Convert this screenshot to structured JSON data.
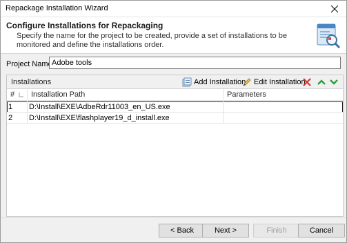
{
  "window": {
    "title": "Repackage Installation Wizard"
  },
  "header": {
    "title": "Configure Installations for Repackaging",
    "description": "Specify the name for the project to be created, provide a set of installations to be monitored and define the installations order."
  },
  "project": {
    "label": "Project Name:",
    "value": "Adobe tools"
  },
  "installations": {
    "panel_title": "Installations",
    "toolbar": {
      "add_label": "Add Installation",
      "edit_label": "Edit Installation"
    },
    "columns": [
      "#",
      "Installation Path",
      "Parameters"
    ],
    "rows": [
      {
        "num": "1",
        "path": "D:\\Install\\EXE\\AdbeRdr11003_en_US.exe",
        "params": ""
      },
      {
        "num": "2",
        "path": "D:\\Install\\EXE\\flashplayer19_d_install.exe",
        "params": ""
      }
    ]
  },
  "buttons": {
    "back": "< Back",
    "next": "Next >",
    "finish": "Finish",
    "cancel": "Cancel"
  }
}
